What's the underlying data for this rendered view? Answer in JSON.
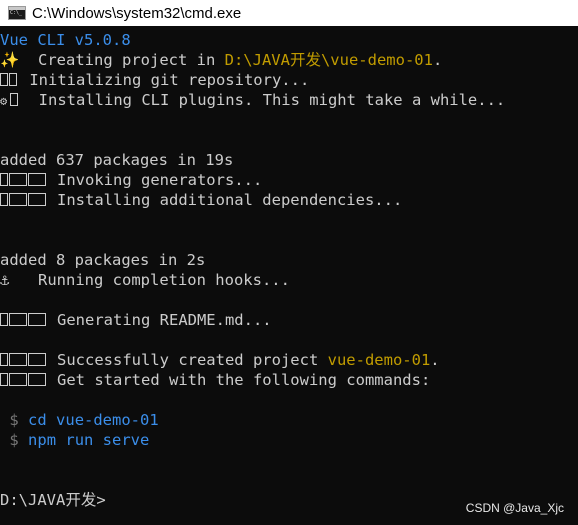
{
  "window": {
    "title": "C:\\Windows\\system32\\cmd.exe"
  },
  "console": {
    "header": "Vue CLI v5.0.8",
    "creating_prefix": "Creating project in ",
    "creating_path": "D:\\JAVA开发\\vue-demo-01",
    "creating_suffix": ".",
    "init_git": "Initializing git repository...",
    "installing_plugins": "Installing CLI plugins. This might take a while...",
    "added_packages_1": "added 637 packages in 19s",
    "invoking_generators": "Invoking generators...",
    "installing_deps": "Installing additional dependencies...",
    "added_packages_2": "added 8 packages in 2s",
    "completion_hooks": "Running completion hooks...",
    "generating_readme": "Generating README.md...",
    "success_prefix": "Successfully created project ",
    "success_project": "vue-demo-01",
    "success_suffix": ".",
    "get_started": "Get started with the following commands:",
    "prompt_symbol": "$",
    "cmd_cd": "cd vue-demo-01",
    "cmd_serve": "npm run serve",
    "final_prompt": "D:\\JAVA开发>"
  },
  "icons": {
    "sparkle": "✨",
    "gear": "⚙",
    "anchor": "⚓"
  },
  "watermark": "CSDN @Java_Xjc",
  "colors": {
    "background": "#0c0c0c",
    "text": "#cccccc",
    "blue": "#3b8eea",
    "yellow": "#c19c00",
    "titlebar": "#ffffff"
  }
}
